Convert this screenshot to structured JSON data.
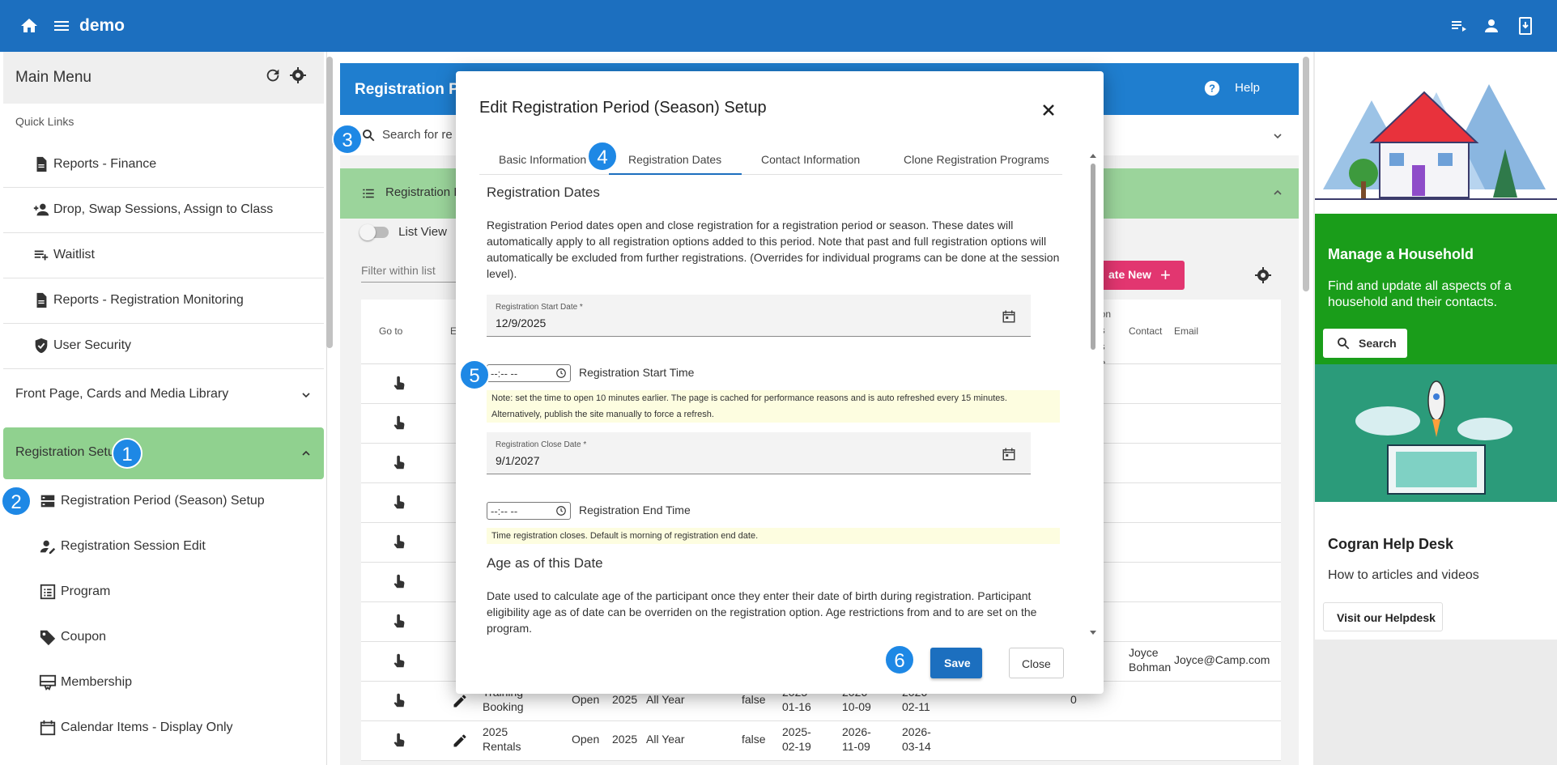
{
  "app": {
    "title": "demo"
  },
  "sidebar": {
    "title": "Main Menu",
    "quick_links_label": "Quick Links",
    "quick_links": [
      {
        "label": "Reports - Finance",
        "icon": "document-icon"
      },
      {
        "label": "Drop, Swap Sessions, Assign to Class",
        "icon": "person-add-icon"
      },
      {
        "label": "Waitlist",
        "icon": "playlist-add-icon"
      },
      {
        "label": "Reports - Registration Monitoring",
        "icon": "document-icon"
      },
      {
        "label": "User Security",
        "icon": "shield-icon"
      }
    ],
    "groups": [
      {
        "label": "Front Page, Cards and Media Library"
      },
      {
        "label": "Registration Setup"
      }
    ],
    "registration_items": [
      {
        "label": "Registration Period (Season) Setup",
        "icon": "dns-icon"
      },
      {
        "label": "Registration Session Edit",
        "icon": "person-edit-icon"
      },
      {
        "label": "Program",
        "icon": "list-alt-icon"
      },
      {
        "label": "Coupon",
        "icon": "tag-icon"
      },
      {
        "label": "Membership",
        "icon": "card-membership-icon"
      },
      {
        "label": "Calendar Items - Display Only",
        "icon": "calendar-icon"
      }
    ]
  },
  "main": {
    "title": "Registration P",
    "help": "Help",
    "search_placeholder": "Search for re",
    "section_title": "Registration I",
    "list_view": "List View",
    "filter_placeholder": "Filter within list",
    "create_new": "ate New",
    "headers": {
      "go_to": "Go to",
      "e": "E",
      "col_a": "ation\nthis\nays\nnce",
      "contact": "Contact",
      "email": "Email"
    },
    "rows": [
      {
        "contact": "Joyce Bohman",
        "email": "Joyce@Camp.com"
      },
      {
        "name": "Training Booking",
        "status": "Open",
        "year": "2025",
        "period": "All Year",
        "flag": "false",
        "d1": "2025-01-16",
        "d2": "2026-10-09",
        "d3": "2026-02-11",
        "count": "0"
      },
      {
        "name": "2025 Rentals",
        "status": "Open",
        "year": "2025",
        "period": "All Year",
        "flag": "false",
        "d1": "2025-02-19",
        "d2": "2026-11-09",
        "d3": "2026-03-14"
      }
    ]
  },
  "right_panel": {
    "household_title": "Manage a Household",
    "household_desc": "Find and update all aspects of a household and their contacts.",
    "search_btn": "Search",
    "helpdesk_title": "Cogran Help Desk",
    "helpdesk_desc": "How to articles and videos",
    "helpdesk_btn": "Visit our Helpdesk"
  },
  "modal": {
    "title": "Edit Registration Period (Season) Setup",
    "tabs": [
      "Basic Information",
      "Registration Dates",
      "Contact Information",
      "Clone Registration Programs"
    ],
    "active_tab": "Registration Dates",
    "section_title": "Registration Dates",
    "description": "Registration Period dates open and close registration for a registration period or season. These dates will automatically apply to all registration options added to this period. Note that past and full registration options will automatically be excluded from further registrations. (Overrides for individual programs can be done at the session level).",
    "start_date": {
      "label": "Registration Start Date *",
      "value": "12/9/2025"
    },
    "start_time": {
      "value": "--:-- --",
      "label": "Registration Start Time"
    },
    "start_note": "Note: set the time to open 10 minutes earlier. The page is cached for performance reasons and is auto refreshed every 15 minutes. Alternatively, publish the site manually to force a refresh.",
    "close_date": {
      "label": "Registration Close Date *",
      "value": "9/1/2027"
    },
    "end_time": {
      "value": "--:-- --",
      "label": "Registration End Time"
    },
    "end_note": "Time registration closes. Default is morning of registration end date.",
    "age_title": "Age as of this Date",
    "age_desc": "Date used to calculate age of the participant once they enter their date of birth during registration. Participant eligibility age as of date can be overriden on the registration option. Age restrictions from and to are set on the program.",
    "save": "Save",
    "close": "Close"
  },
  "markers": [
    "1",
    "2",
    "3",
    "4",
    "5",
    "6"
  ],
  "colors": {
    "topbar": "#1c6fbf",
    "green": "#1a9d1a",
    "marker": "#1e88e5",
    "save": "#1c6fbf"
  }
}
